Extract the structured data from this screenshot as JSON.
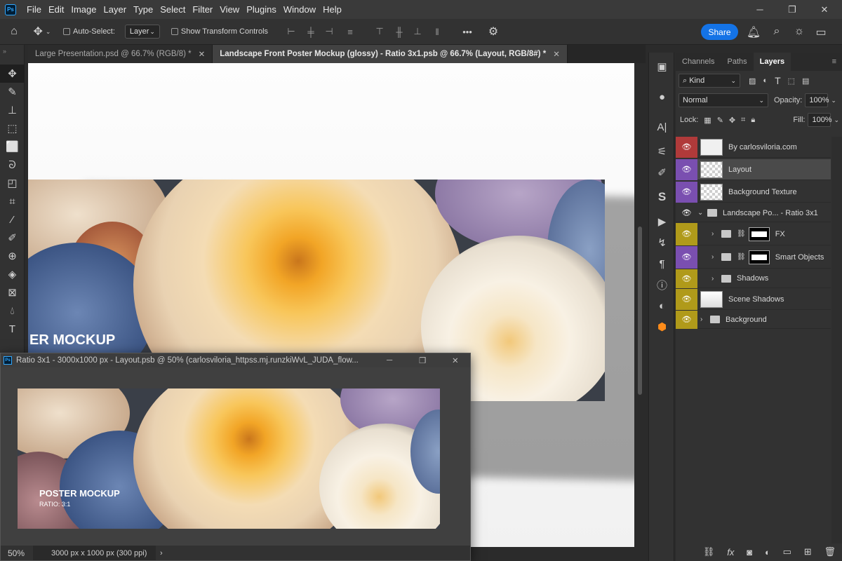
{
  "menu": [
    "File",
    "Edit",
    "Image",
    "Layer",
    "Type",
    "Select",
    "Filter",
    "View",
    "Plugins",
    "Window",
    "Help"
  ],
  "window_controls": {
    "minimize": "─",
    "restore": "❐",
    "close": "✕"
  },
  "options": {
    "auto_select_label": "Auto-Select:",
    "auto_select_target": "Layer",
    "show_transform_label": "Show Transform Controls",
    "more": "•••",
    "share_label": "Share"
  },
  "tabs": [
    {
      "label": "Large Presentation.psd @ 66.7% (RGB/8) *",
      "active": false
    },
    {
      "label": "Landscape Front Poster Mockup (glossy) - Ratio 3x1.psb @ 66.7% (Layout, RGB/8#) *",
      "active": true
    }
  ],
  "poster": {
    "headline_main": "ER MOCKUP",
    "float_headline": "POSTER MOCKUP",
    "float_sub": "RATIO: 3:1"
  },
  "float_window": {
    "title": "Ratio 3x1 - 3000x1000 px - Layout.psb @ 50% (carlosviloria_httpss.mj.runzkiWvL_JUDA_flow...",
    "zoom": "50%",
    "doc_size": "3000 px x 1000 px (300 ppi)"
  },
  "panel": {
    "tabs": [
      "Channels",
      "Paths",
      "Layers"
    ],
    "kind_label": "Kind",
    "blend_mode": "Normal",
    "opacity_label": "Opacity:",
    "opacity_value": "100%",
    "lock_label": "Lock:",
    "fill_label": "Fill:",
    "fill_value": "100%"
  },
  "layers": [
    {
      "name": "By carlosviloria.com",
      "color": "#b03a3a",
      "type": "plain"
    },
    {
      "name": "Layout",
      "color": "#7a4fb0",
      "type": "smart",
      "selected": true
    },
    {
      "name": "Background Texture",
      "color": "#7a4fb0",
      "type": "smart"
    },
    {
      "name": "Landscape Po... - Ratio 3x1",
      "color": "",
      "type": "group-open"
    },
    {
      "name": "FX",
      "color": "#b09a1a",
      "type": "group-mask"
    },
    {
      "name": "Smart Objects",
      "color": "#7a4fb0",
      "type": "group-mask"
    },
    {
      "name": "Shadows",
      "color": "#b09a1a",
      "type": "group"
    },
    {
      "name": "Scene Shadows",
      "color": "#b09a1a",
      "type": "plain"
    },
    {
      "name": "Background",
      "color": "#b09a1a",
      "type": "group-top"
    }
  ]
}
